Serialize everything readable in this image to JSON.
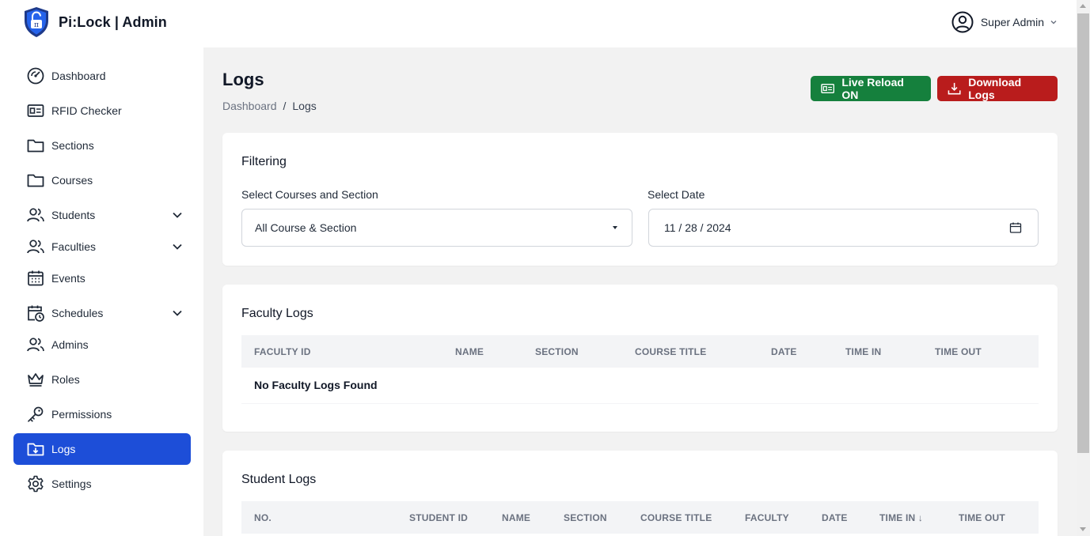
{
  "app": {
    "title": "Pi:Lock | Admin"
  },
  "user": {
    "name": "Super Admin"
  },
  "sidebar": {
    "items": [
      {
        "label": "Dashboard",
        "icon": "dashboard-gauge-icon"
      },
      {
        "label": "RFID Checker",
        "icon": "id-card-icon"
      },
      {
        "label": "Sections",
        "icon": "folder-icon"
      },
      {
        "label": "Courses",
        "icon": "folder-icon"
      },
      {
        "label": "Students",
        "icon": "users-icon",
        "expandable": true
      },
      {
        "label": "Faculties",
        "icon": "users-icon",
        "expandable": true
      },
      {
        "label": "Events",
        "icon": "calendar-icon"
      },
      {
        "label": "Schedules",
        "icon": "calendar-clock-icon",
        "expandable": true
      },
      {
        "label": "Admins",
        "icon": "users-icon"
      },
      {
        "label": "Roles",
        "icon": "crown-icon"
      },
      {
        "label": "Permissions",
        "icon": "key-icon"
      },
      {
        "label": "Logs",
        "icon": "folder-download-icon",
        "active": true
      },
      {
        "label": "Settings",
        "icon": "gear-icon"
      }
    ]
  },
  "page": {
    "title": "Logs",
    "breadcrumb": {
      "parent": "Dashboard",
      "separator": "/",
      "current": "Logs"
    }
  },
  "actions": {
    "live_reload": "Live Reload ON",
    "download": "Download Logs"
  },
  "filtering": {
    "title": "Filtering",
    "course_label": "Select Courses and Section",
    "course_value": "All Course & Section",
    "date_label": "Select Date",
    "date_value": "11 / 28 / 2024"
  },
  "faculty_logs": {
    "title": "Faculty Logs",
    "columns": [
      "FACULTY ID",
      "NAME",
      "SECTION",
      "COURSE TITLE",
      "DATE",
      "TIME IN",
      "TIME OUT"
    ],
    "empty_message": "No Faculty Logs Found"
  },
  "student_logs": {
    "title": "Student Logs",
    "columns": [
      "NO.",
      "STUDENT ID",
      "NAME",
      "SECTION",
      "COURSE TITLE",
      "FACULTY",
      "DATE",
      "TIME IN ↓",
      "TIME OUT"
    ]
  },
  "colors": {
    "active_nav": "#1d4ed8",
    "live_reload_button": "#15803d",
    "download_button": "#b91c1c",
    "main_background": "#f2f2f2",
    "scrollbar": "#c1c1c1"
  }
}
